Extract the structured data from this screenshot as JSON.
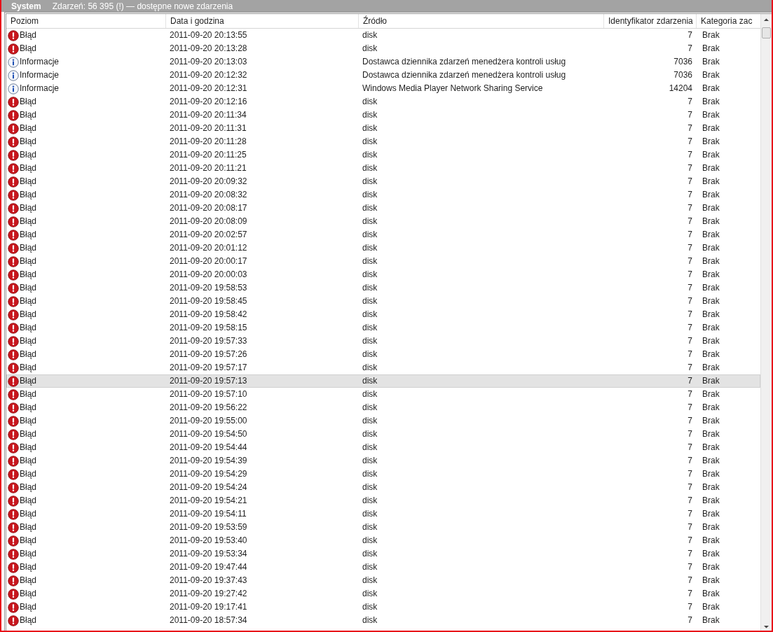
{
  "title_bar": {
    "log": "System",
    "summary": "Zdarzeń: 56 395 (!) — dostępne nowe zdarzenia"
  },
  "table": {
    "columns": [
      "Poziom",
      "Data i godzina",
      "Źródło",
      "Identyfikator zdarzenia",
      "Kategoria zac"
    ],
    "rows": [
      {
        "kind": "error",
        "level": "Błąd",
        "date": "2011-09-20 20:13:55",
        "source": "disk",
        "id": "7",
        "category": "Brak",
        "selected": false
      },
      {
        "kind": "error",
        "level": "Błąd",
        "date": "2011-09-20 20:13:28",
        "source": "disk",
        "id": "7",
        "category": "Brak",
        "selected": false
      },
      {
        "kind": "info",
        "level": "Informacje",
        "date": "2011-09-20 20:13:03",
        "source": "Dostawca dziennika zdarzeń menedżera kontroli usług",
        "id": "7036",
        "category": "Brak",
        "selected": false
      },
      {
        "kind": "info",
        "level": "Informacje",
        "date": "2011-09-20 20:12:32",
        "source": "Dostawca dziennika zdarzeń menedżera kontroli usług",
        "id": "7036",
        "category": "Brak",
        "selected": false
      },
      {
        "kind": "info",
        "level": "Informacje",
        "date": "2011-09-20 20:12:31",
        "source": "Windows Media Player Network Sharing Service",
        "id": "14204",
        "category": "Brak",
        "selected": false
      },
      {
        "kind": "error",
        "level": "Błąd",
        "date": "2011-09-20 20:12:16",
        "source": "disk",
        "id": "7",
        "category": "Brak",
        "selected": false
      },
      {
        "kind": "error",
        "level": "Błąd",
        "date": "2011-09-20 20:11:34",
        "source": "disk",
        "id": "7",
        "category": "Brak",
        "selected": false
      },
      {
        "kind": "error",
        "level": "Błąd",
        "date": "2011-09-20 20:11:31",
        "source": "disk",
        "id": "7",
        "category": "Brak",
        "selected": false
      },
      {
        "kind": "error",
        "level": "Błąd",
        "date": "2011-09-20 20:11:28",
        "source": "disk",
        "id": "7",
        "category": "Brak",
        "selected": false
      },
      {
        "kind": "error",
        "level": "Błąd",
        "date": "2011-09-20 20:11:25",
        "source": "disk",
        "id": "7",
        "category": "Brak",
        "selected": false
      },
      {
        "kind": "error",
        "level": "Błąd",
        "date": "2011-09-20 20:11:21",
        "source": "disk",
        "id": "7",
        "category": "Brak",
        "selected": false
      },
      {
        "kind": "error",
        "level": "Błąd",
        "date": "2011-09-20 20:09:32",
        "source": "disk",
        "id": "7",
        "category": "Brak",
        "selected": false
      },
      {
        "kind": "error",
        "level": "Błąd",
        "date": "2011-09-20 20:08:32",
        "source": "disk",
        "id": "7",
        "category": "Brak",
        "selected": false
      },
      {
        "kind": "error",
        "level": "Błąd",
        "date": "2011-09-20 20:08:17",
        "source": "disk",
        "id": "7",
        "category": "Brak",
        "selected": false
      },
      {
        "kind": "error",
        "level": "Błąd",
        "date": "2011-09-20 20:08:09",
        "source": "disk",
        "id": "7",
        "category": "Brak",
        "selected": false
      },
      {
        "kind": "error",
        "level": "Błąd",
        "date": "2011-09-20 20:02:57",
        "source": "disk",
        "id": "7",
        "category": "Brak",
        "selected": false
      },
      {
        "kind": "error",
        "level": "Błąd",
        "date": "2011-09-20 20:01:12",
        "source": "disk",
        "id": "7",
        "category": "Brak",
        "selected": false
      },
      {
        "kind": "error",
        "level": "Błąd",
        "date": "2011-09-20 20:00:17",
        "source": "disk",
        "id": "7",
        "category": "Brak",
        "selected": false
      },
      {
        "kind": "error",
        "level": "Błąd",
        "date": "2011-09-20 20:00:03",
        "source": "disk",
        "id": "7",
        "category": "Brak",
        "selected": false
      },
      {
        "kind": "error",
        "level": "Błąd",
        "date": "2011-09-20 19:58:53",
        "source": "disk",
        "id": "7",
        "category": "Brak",
        "selected": false
      },
      {
        "kind": "error",
        "level": "Błąd",
        "date": "2011-09-20 19:58:45",
        "source": "disk",
        "id": "7",
        "category": "Brak",
        "selected": false
      },
      {
        "kind": "error",
        "level": "Błąd",
        "date": "2011-09-20 19:58:42",
        "source": "disk",
        "id": "7",
        "category": "Brak",
        "selected": false
      },
      {
        "kind": "error",
        "level": "Błąd",
        "date": "2011-09-20 19:58:15",
        "source": "disk",
        "id": "7",
        "category": "Brak",
        "selected": false
      },
      {
        "kind": "error",
        "level": "Błąd",
        "date": "2011-09-20 19:57:33",
        "source": "disk",
        "id": "7",
        "category": "Brak",
        "selected": false
      },
      {
        "kind": "error",
        "level": "Błąd",
        "date": "2011-09-20 19:57:26",
        "source": "disk",
        "id": "7",
        "category": "Brak",
        "selected": false
      },
      {
        "kind": "error",
        "level": "Błąd",
        "date": "2011-09-20 19:57:17",
        "source": "disk",
        "id": "7",
        "category": "Brak",
        "selected": false
      },
      {
        "kind": "error",
        "level": "Błąd",
        "date": "2011-09-20 19:57:13",
        "source": "disk",
        "id": "7",
        "category": "Brak",
        "selected": true
      },
      {
        "kind": "error",
        "level": "Błąd",
        "date": "2011-09-20 19:57:10",
        "source": "disk",
        "id": "7",
        "category": "Brak",
        "selected": false
      },
      {
        "kind": "error",
        "level": "Błąd",
        "date": "2011-09-20 19:56:22",
        "source": "disk",
        "id": "7",
        "category": "Brak",
        "selected": false
      },
      {
        "kind": "error",
        "level": "Błąd",
        "date": "2011-09-20 19:55:00",
        "source": "disk",
        "id": "7",
        "category": "Brak",
        "selected": false
      },
      {
        "kind": "error",
        "level": "Błąd",
        "date": "2011-09-20 19:54:50",
        "source": "disk",
        "id": "7",
        "category": "Brak",
        "selected": false
      },
      {
        "kind": "error",
        "level": "Błąd",
        "date": "2011-09-20 19:54:44",
        "source": "disk",
        "id": "7",
        "category": "Brak",
        "selected": false
      },
      {
        "kind": "error",
        "level": "Błąd",
        "date": "2011-09-20 19:54:39",
        "source": "disk",
        "id": "7",
        "category": "Brak",
        "selected": false
      },
      {
        "kind": "error",
        "level": "Błąd",
        "date": "2011-09-20 19:54:29",
        "source": "disk",
        "id": "7",
        "category": "Brak",
        "selected": false
      },
      {
        "kind": "error",
        "level": "Błąd",
        "date": "2011-09-20 19:54:24",
        "source": "disk",
        "id": "7",
        "category": "Brak",
        "selected": false
      },
      {
        "kind": "error",
        "level": "Błąd",
        "date": "2011-09-20 19:54:21",
        "source": "disk",
        "id": "7",
        "category": "Brak",
        "selected": false
      },
      {
        "kind": "error",
        "level": "Błąd",
        "date": "2011-09-20 19:54:11",
        "source": "disk",
        "id": "7",
        "category": "Brak",
        "selected": false
      },
      {
        "kind": "error",
        "level": "Błąd",
        "date": "2011-09-20 19:53:59",
        "source": "disk",
        "id": "7",
        "category": "Brak",
        "selected": false
      },
      {
        "kind": "error",
        "level": "Błąd",
        "date": "2011-09-20 19:53:40",
        "source": "disk",
        "id": "7",
        "category": "Brak",
        "selected": false
      },
      {
        "kind": "error",
        "level": "Błąd",
        "date": "2011-09-20 19:53:34",
        "source": "disk",
        "id": "7",
        "category": "Brak",
        "selected": false
      },
      {
        "kind": "error",
        "level": "Błąd",
        "date": "2011-09-20 19:47:44",
        "source": "disk",
        "id": "7",
        "category": "Brak",
        "selected": false
      },
      {
        "kind": "error",
        "level": "Błąd",
        "date": "2011-09-20 19:37:43",
        "source": "disk",
        "id": "7",
        "category": "Brak",
        "selected": false
      },
      {
        "kind": "error",
        "level": "Błąd",
        "date": "2011-09-20 19:27:42",
        "source": "disk",
        "id": "7",
        "category": "Brak",
        "selected": false
      },
      {
        "kind": "error",
        "level": "Błąd",
        "date": "2011-09-20 19:17:41",
        "source": "disk",
        "id": "7",
        "category": "Brak",
        "selected": false
      },
      {
        "kind": "error",
        "level": "Błąd",
        "date": "2011-09-20 18:57:34",
        "source": "disk",
        "id": "7",
        "category": "Brak",
        "selected": false
      }
    ]
  }
}
